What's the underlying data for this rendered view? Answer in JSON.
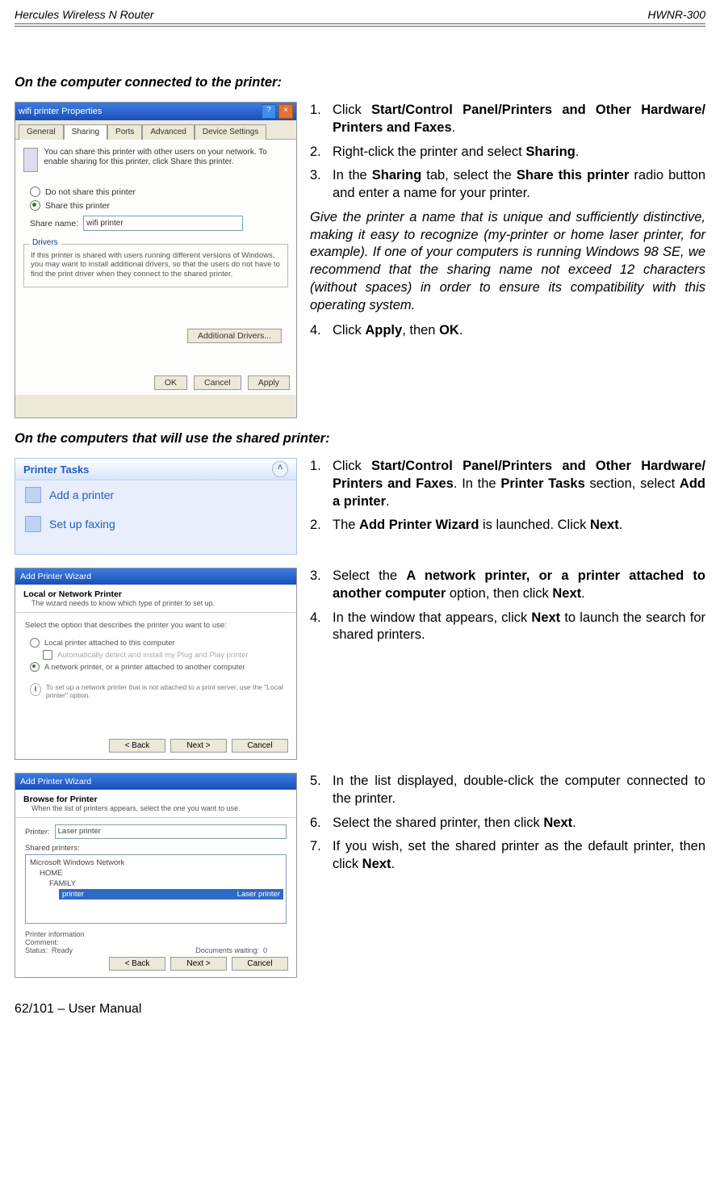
{
  "header": {
    "left": "Hercules Wireless N Router",
    "right": "HWNR-300"
  },
  "section1": {
    "title": "On the computer connected to the printer:",
    "steps": [
      "Click <b>Start/Control Panel/Printers and Other Hardware/ Printers and Faxes</b>.",
      "Right-click the printer and select <b>Sharing</b>.",
      "In the <b>Sharing</b> tab, select the <b>Share this printer</b> radio button and enter a name for your printer."
    ],
    "note": "Give the printer a name that is unique and sufficiently distinctive, making it easy to recognize (my-printer or home laser printer, for example).  If one of your computers is running Windows 98 SE, we recommend that the sharing name not exceed 12 characters (without spaces) in order to ensure its compatibility with this operating system.",
    "step4": "Click <b>Apply</b>, then <b>OK</b>."
  },
  "section2": {
    "title": "On the computers that will use the shared printer:",
    "block1": [
      "Click <b>Start/Control Panel/Printers and Other Hardware/ Printers and Faxes</b>.  In the <b>Printer Tasks</b> section, select <b>Add a printer</b>.",
      "The <b>Add Printer Wizard</b> is launched.  Click <b>Next</b>."
    ],
    "block2": [
      "Select the <b>A network printer, or a printer attached to another computer</b> option, then click <b>Next</b>.",
      "In the window that appears, click <b>Next</b> to launch the search for shared printers."
    ],
    "block3": [
      "In the list displayed, double-click the computer connected to the printer.",
      "Select the shared printer, then click <b>Next</b>.",
      "If you wish, set the shared printer as the default printer, then click <b>Next</b>."
    ]
  },
  "ss1": {
    "title": "wifi printer Properties",
    "tabs": [
      "General",
      "Sharing",
      "Ports",
      "Advanced",
      "Device Settings"
    ],
    "desc": "You can share this printer with other users on your network. To enable sharing for this printer, click Share this printer.",
    "radio1": "Do not share this printer",
    "radio2": "Share this printer",
    "sharelabel": "Share name:",
    "sharevalue": "wifi printer",
    "drivers_title": "Drivers",
    "drivers_desc": "If this printer is shared with users running different versions of Windows, you may want to install additional drivers, so that the users do not have to find the print driver when they connect to the shared printer.",
    "additional": "Additional Drivers...",
    "ok": "OK",
    "cancel": "Cancel",
    "apply": "Apply"
  },
  "ss2": {
    "title": "Printer Tasks",
    "item1": "Add a printer",
    "item2": "Set up faxing"
  },
  "ss3": {
    "title": "Add Printer Wizard",
    "h1": "Local or Network Printer",
    "h2": "The wizard needs to know which type of printer to set up.",
    "lead": "Select the option that describes the printer you want to use:",
    "opt1": "Local printer attached to this computer",
    "opt1b": "Automatically detect and install my Plug and Play printer",
    "opt2": "A network printer, or a printer attached to another computer",
    "note": "To set up a network printer that is not attached to a print server, use the \"Local printer\" option.",
    "back": "< Back",
    "next": "Next >",
    "cancel": "Cancel"
  },
  "ss4": {
    "title": "Add Printer Wizard",
    "h1": "Browse for Printer",
    "h2": "When the list of printers appears, select the one you want to use.",
    "printerlabel": "Printer:",
    "printervalue": "Laser printer",
    "sharedlabel": "Shared printers:",
    "tree_root": "Microsoft Windows Network",
    "tree_home": "HOME",
    "tree_family": "FAMILY",
    "tree_sel_name": "printer",
    "tree_sel_desc": "Laser printer",
    "info_title": "Printer information",
    "comment": "Comment:",
    "status": "Status:",
    "status_val": "Ready",
    "docs": "Documents waiting:",
    "docs_val": "0",
    "back": "< Back",
    "next": "Next >",
    "cancel": "Cancel"
  },
  "footer": "62/101 – User Manual"
}
